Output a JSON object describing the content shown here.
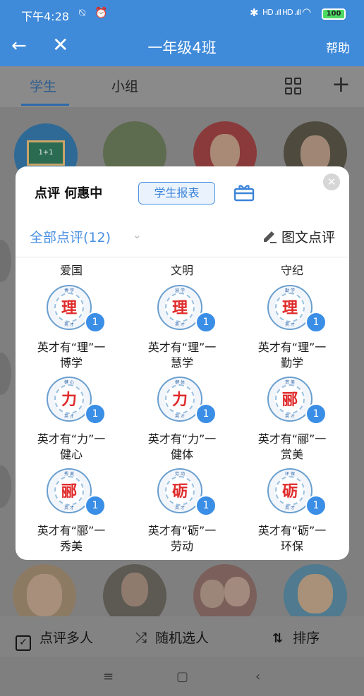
{
  "status_bar": {
    "time": "下午4:28",
    "battery": "100",
    "signal1": "HD .ıll",
    "signal2": "HD .ıll"
  },
  "header": {
    "title": "一年级4班",
    "help": "帮助"
  },
  "tabs": {
    "students": "学生",
    "groups": "小组"
  },
  "modal": {
    "title": "点评 何惠中",
    "report_button": "学生报表",
    "filter": "全部点评(12)",
    "image_review": "图文点评",
    "column_labels": [
      "爱国",
      "文明",
      "守纪"
    ],
    "items": [
      {
        "char": "理",
        "top": "博 学",
        "bot": "英 才",
        "line1": "英才有“理”一",
        "line2": "博学",
        "count": "1"
      },
      {
        "char": "理",
        "top": "慧 学",
        "bot": "英 才",
        "line1": "英才有“理”一",
        "line2": "慧学",
        "count": "1"
      },
      {
        "char": "理",
        "top": "勤 学",
        "bot": "英 才",
        "line1": "英才有“理”一",
        "line2": "勤学",
        "count": "1"
      },
      {
        "char": "力",
        "top": "健 心",
        "bot": "英 才",
        "line1": "英才有“力”一",
        "line2": "健心",
        "count": "1"
      },
      {
        "char": "力",
        "top": "健 体",
        "bot": "英 才",
        "line1": "英才有“力”一",
        "line2": "健体",
        "count": "1"
      },
      {
        "char": "郦",
        "top": "赏 美",
        "bot": "英 才",
        "line1": "英才有“郦”一",
        "line2": "赏美",
        "count": "1"
      },
      {
        "char": "郦",
        "top": "秀 美",
        "bot": "英 才",
        "line1": "英才有“郦”一",
        "line2": "秀美",
        "count": "1"
      },
      {
        "char": "砺",
        "top": "劳 动",
        "bot": "英 才",
        "line1": "英才有“砺”一",
        "line2": "劳动",
        "count": "1"
      },
      {
        "char": "砺",
        "top": "环 保",
        "bot": "英 才",
        "line1": "英才有“砺”一",
        "line2": "环保",
        "count": "1"
      }
    ]
  },
  "bottom_bar": {
    "multi_review": "点评多人",
    "random_pick": "随机选人",
    "sort": "排序"
  },
  "colors": {
    "primary": "#3f8ad9",
    "accent": "#4a90e2",
    "badge": "#3a8ee6",
    "medal_red": "#e02b2b"
  }
}
